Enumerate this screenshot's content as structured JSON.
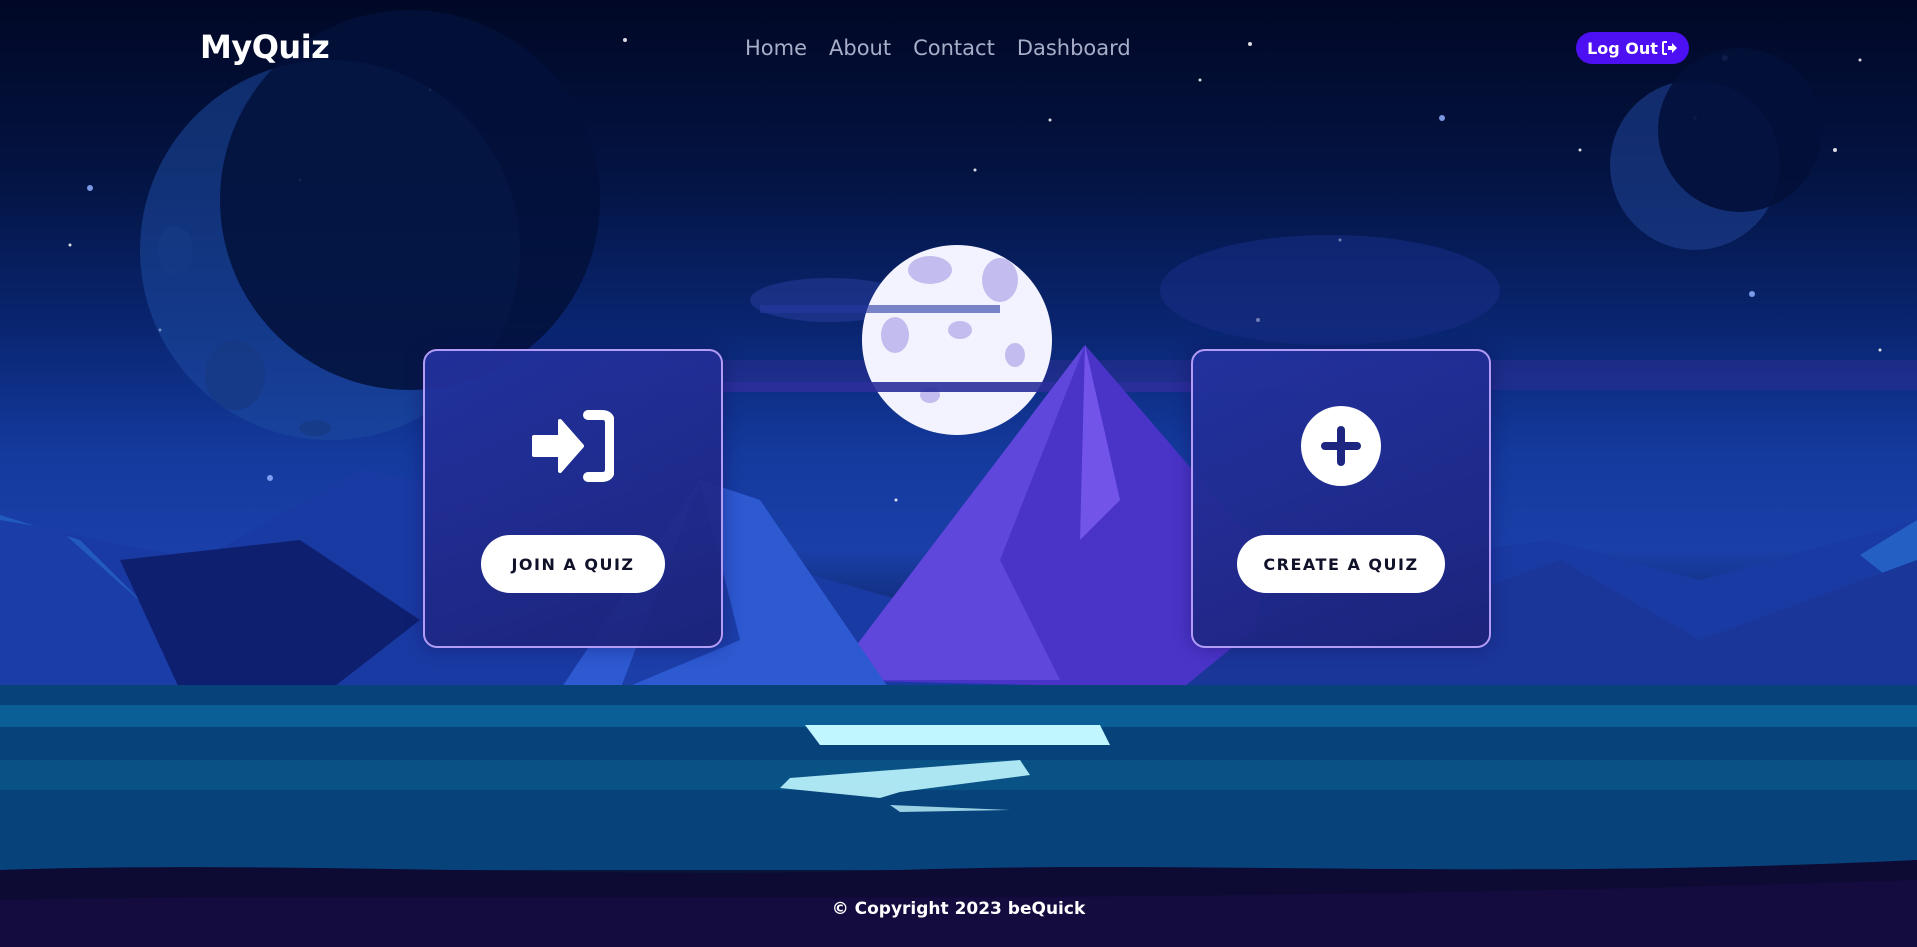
{
  "brand": {
    "name": "MyQuiz"
  },
  "nav": {
    "links": [
      "Home",
      "About",
      "Contact",
      "Dashboard"
    ]
  },
  "auth": {
    "logout_label": "Log Out",
    "logout_icon": "sign-out-icon"
  },
  "cards": {
    "join": {
      "label": "JOIN A QUIZ",
      "icon": "sign-in-icon"
    },
    "create": {
      "label": "CREATE A QUIZ",
      "icon": "plus-circle-icon"
    }
  },
  "footer": {
    "text": "© Copyright 2023 beQuick"
  },
  "colors": {
    "accent": "#4d10f2",
    "card_border": "#b29cf5",
    "text": "#ffffff",
    "nav_text": "#a8adc8"
  }
}
